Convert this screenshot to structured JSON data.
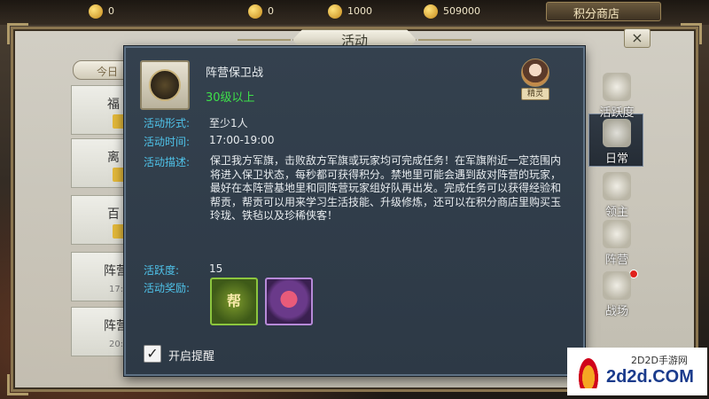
{
  "currencies": [
    {
      "name": "silver",
      "value": "0"
    },
    {
      "name": "silver-2",
      "value": "0"
    },
    {
      "name": "jade",
      "value": "1000"
    },
    {
      "name": "gold",
      "value": "509000"
    }
  ],
  "shop": {
    "label": "积分商店"
  },
  "dialog": {
    "title": "活动",
    "close_label": "×",
    "activity_name": "阵营保卫战",
    "level_req": "30级以上",
    "sprite_label": "精灵",
    "fields": {
      "form_label": "活动形式:",
      "form_value": "至少1人",
      "time_label": "活动时间:",
      "time_value": "17:00-19:00",
      "desc_label": "活动描述:",
      "desc_value": "保卫我方军旗，击败敌方军旗或玩家均可完成任务！在军旗附近一定范围内将进入保卫状态，每秒都可获得积分。禁地里可能会遇到敌对阵营的玩家，最好在本阵营基地里和同阵营玩家组好队再出发。完成任务可以获得经验和帮贡，帮贡可以用来学习生活技能、升级修炼，还可以在积分商店里购买玉玲珑、铁毡以及珍稀侠客！",
      "activity_label": "活跃度:",
      "activity_value": "15",
      "reward_label": "活动奖励:"
    },
    "rewards": [
      {
        "name": "guild-bag",
        "glyph": "帮"
      },
      {
        "name": "pearl-treasure",
        "glyph": ""
      }
    ],
    "remind": {
      "checked": "✓",
      "label": "开启提醒"
    }
  },
  "left_list": {
    "tab": "今日",
    "items": [
      {
        "label": "福",
        "time": ""
      },
      {
        "label": "离",
        "time": ""
      },
      {
        "label": "百",
        "time": ""
      },
      {
        "label": "阵营",
        "time": "17:"
      },
      {
        "label": "阵营",
        "time": "20:"
      }
    ]
  },
  "side_nav": [
    {
      "label": "活跃度"
    },
    {
      "label": "日常"
    },
    {
      "label": "领主"
    },
    {
      "label": "阵营"
    },
    {
      "label": "战场"
    }
  ],
  "watermark": {
    "small": "2D2D手游网",
    "big": "2d2d.COM"
  },
  "colors": {
    "accent_label": "#4fc3ea",
    "level_green": "#3ee04a",
    "dialog_bg": "#34414e"
  }
}
